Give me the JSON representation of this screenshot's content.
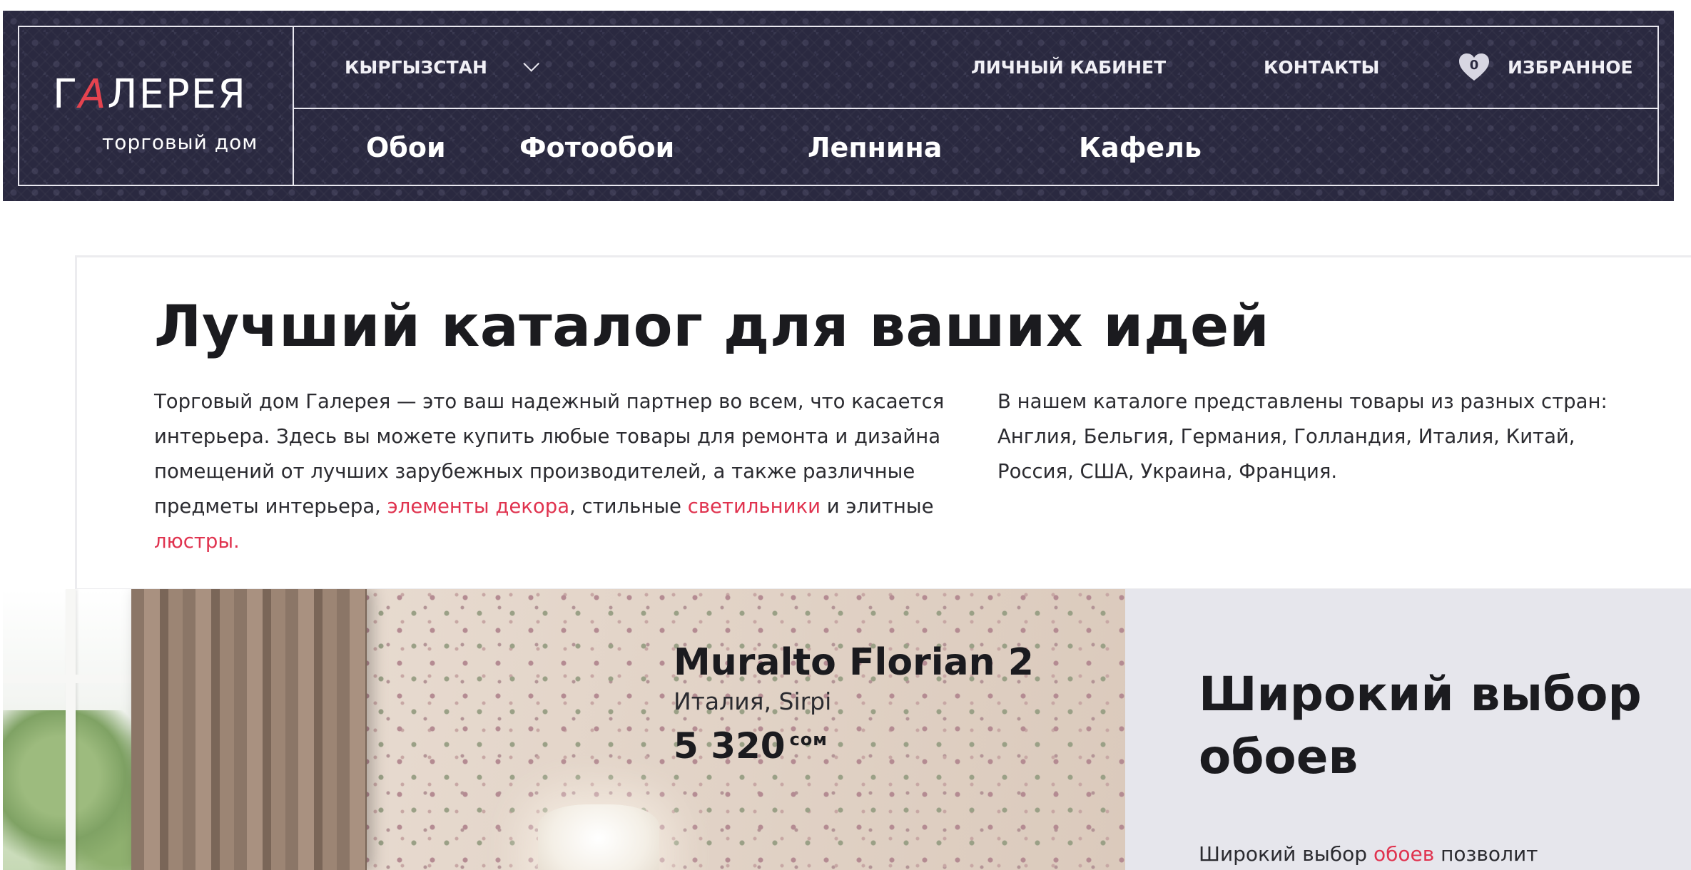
{
  "header": {
    "logo": {
      "main_prefix": "Г",
      "main_accent": "А",
      "main_suffix": "ЛЕРЕЯ",
      "subtitle": "торговый дом"
    },
    "region": "КЫРГЫЗСТАН",
    "top_links": {
      "account": "ЛИЧНЫЙ КАБИНЕТ",
      "contacts": "КОНТАКТЫ",
      "favorites": "ИЗБРАННОЕ"
    },
    "favorites_count": "0",
    "nav": [
      "Обои",
      "Фотообои",
      "Лепнина",
      "Кафель"
    ]
  },
  "intro": {
    "title": "Лучший каталог для ваших идей",
    "left_text_1": "Торговый дом Галерея — это ваш надежный партнер во всем, что касается интерьера. Здесь вы можете купить любые товары для ремонта и дизайна помещений от лучших зарубежных производителей, а также различные предметы интерьера, ",
    "link_decor": "элементы декора",
    "left_text_2": ", стильные ",
    "link_lights": "светильники",
    "left_text_3": " и элитные ",
    "link_chandeliers": "люстры.",
    "right_text": "В нашем каталоге представлены товары из разных стран: Англия, Бельгия, Германия, Голландия, Италия, Китай, Россия, США, Украина, Франция."
  },
  "product": {
    "name": "Muralto Florian 2",
    "origin": "Италия, Sirpi",
    "price": "5 320",
    "currency": "сом"
  },
  "side": {
    "title": "Широкий выбор обоев",
    "text_before": "Широкий выбор ",
    "link": "обоев",
    "text_after": " позволит"
  },
  "colors": {
    "header_bg": "#2a2940",
    "accent_red": "#e0334f",
    "side_bg": "#e6e6ec"
  }
}
